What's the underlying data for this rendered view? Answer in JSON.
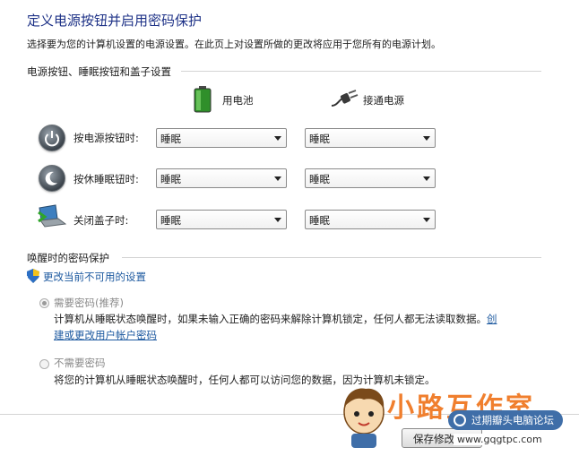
{
  "page": {
    "title": "定义电源按钮并启用密码保护",
    "subtitle": "选择要为您的计算机设置的电源设置。在此页上对设置所做的更改将应用于您所有的电源计划。"
  },
  "power_section": {
    "header": "电源按钮、睡眠按钮和盖子设置",
    "col_battery": "用电池",
    "col_ac": "接通电源",
    "rows": [
      {
        "label": "按电源按钮时:",
        "battery": "睡眠",
        "ac": "睡眠"
      },
      {
        "label": "按休睡眠钮时:",
        "battery": "睡眠",
        "ac": "睡眠"
      },
      {
        "label": "关闭盖子时:",
        "battery": "睡眠",
        "ac": "睡眠"
      }
    ]
  },
  "password_section": {
    "header": "唤醒时的密码保护",
    "change_link": "更改当前不可用的设置",
    "option_require": {
      "label": "需要密码(推荐)",
      "desc_1": "计算机从睡眠状态唤醒时，如果未输入正确的密码来解除计算机锁定，任何人都无法读取数据。",
      "desc_link_1": "创",
      "desc_link_2": "建或更改用户帐户密码",
      "selected": true
    },
    "option_none": {
      "label": "不需要密码",
      "desc": "将您的计算机从睡眠状态唤醒时，任何人都可以访问您的数据，因为计算机未锁定。",
      "selected": false
    }
  },
  "footer": {
    "save_label": "保存修改"
  },
  "watermark": {
    "text": "小路互作室",
    "badge": "过期瓣头电脑论坛",
    "url": "www.gqgtpc.com"
  },
  "icons": {
    "battery": "battery-icon",
    "ac": "power-plug-icon",
    "power_button": "power-button-icon",
    "sleep_button": "sleep-button-icon",
    "lid": "laptop-lid-icon",
    "shield": "uac-shield-icon"
  }
}
